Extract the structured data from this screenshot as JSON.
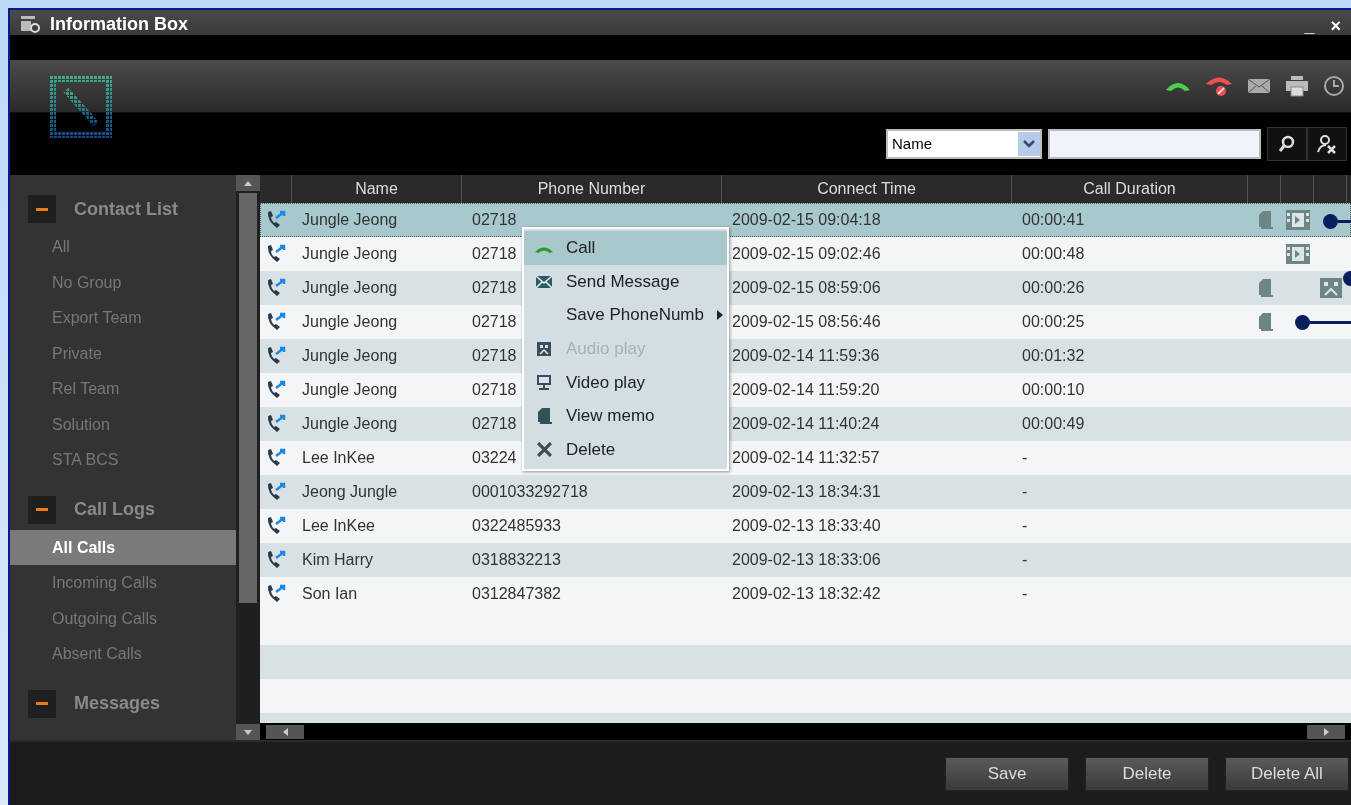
{
  "window": {
    "title": "Information Box",
    "minimize": "_",
    "close": "×"
  },
  "search": {
    "field_choice": "Name"
  },
  "sidebar": {
    "groups": [
      {
        "title": "Contact List",
        "expanded": true,
        "items": [
          {
            "label": "All",
            "selected": false
          },
          {
            "label": "No Group",
            "selected": false
          },
          {
            "label": "Export Team",
            "selected": false
          },
          {
            "label": "Private",
            "selected": false
          },
          {
            "label": "Rel Team",
            "selected": false
          },
          {
            "label": "Solution",
            "selected": false
          },
          {
            "label": "STA BCS",
            "selected": false
          }
        ]
      },
      {
        "title": "Call Logs",
        "expanded": true,
        "items": [
          {
            "label": "All Calls",
            "selected": true
          },
          {
            "label": "Incoming Calls",
            "selected": false
          },
          {
            "label": "Outgoing Calls",
            "selected": false
          },
          {
            "label": "Absent Calls",
            "selected": false
          }
        ]
      },
      {
        "title": "Messages",
        "expanded": true
      }
    ]
  },
  "table": {
    "columns": [
      "Name",
      "Phone Number",
      "Connect Time",
      "Call Duration"
    ],
    "rows": [
      {
        "name": "Jungle Jeong",
        "phone": "02718",
        "time": "2009-02-15 09:04:18",
        "duration": "00:00:41",
        "selected": true,
        "memo": true,
        "video": true,
        "audio": false
      },
      {
        "name": "Jungle Jeong",
        "phone": "02718",
        "time": "2009-02-15 09:02:46",
        "duration": "00:00:48",
        "selected": false,
        "memo": false,
        "video": true,
        "audio": false
      },
      {
        "name": "Jungle Jeong",
        "phone": "02718",
        "time": "2009-02-15 08:59:06",
        "duration": "00:00:26",
        "selected": false,
        "memo": true,
        "video": false,
        "audio": true
      },
      {
        "name": "Jungle Jeong",
        "phone": "02718",
        "time": "2009-02-15 08:56:46",
        "duration": "00:00:25",
        "selected": false,
        "memo": true,
        "video": false,
        "audio": false
      },
      {
        "name": "Jungle Jeong",
        "phone": "02718",
        "time": "2009-02-14 11:59:36",
        "duration": "00:01:32",
        "selected": false,
        "memo": false,
        "video": false,
        "audio": false
      },
      {
        "name": "Jungle Jeong",
        "phone": "02718",
        "time": "2009-02-14 11:59:20",
        "duration": "00:00:10",
        "selected": false,
        "memo": false,
        "video": false,
        "audio": false
      },
      {
        "name": "Jungle Jeong",
        "phone": "02718",
        "time": "2009-02-14 11:40:24",
        "duration": "00:00:49",
        "selected": false,
        "memo": false,
        "video": false,
        "audio": false
      },
      {
        "name": "Lee InKee",
        "phone": "03224",
        "time": "2009-02-14 11:32:57",
        "duration": "-",
        "selected": false,
        "memo": false,
        "video": false,
        "audio": false
      },
      {
        "name": "Jeong Jungle",
        "phone": "0001033292718",
        "time": "2009-02-13 18:34:31",
        "duration": "-",
        "selected": false,
        "memo": false,
        "video": false,
        "audio": false
      },
      {
        "name": "Lee InKee",
        "phone": "0322485933",
        "time": "2009-02-13 18:33:40",
        "duration": "-",
        "selected": false,
        "memo": false,
        "video": false,
        "audio": false
      },
      {
        "name": "Kim Harry",
        "phone": "0318832213",
        "time": "2009-02-13 18:33:06",
        "duration": "-",
        "selected": false,
        "memo": false,
        "video": false,
        "audio": false
      },
      {
        "name": "Son Ian",
        "phone": "0312847382",
        "time": "2009-02-13 18:32:42",
        "duration": "-",
        "selected": false,
        "memo": false,
        "video": false,
        "audio": false
      }
    ]
  },
  "context_menu": {
    "items": [
      {
        "label": "Call",
        "selected": true,
        "disabled": false,
        "submenu": false
      },
      {
        "label": "Send Message",
        "selected": false,
        "disabled": false,
        "submenu": false
      },
      {
        "label": "Save PhoneNumb",
        "selected": false,
        "disabled": false,
        "submenu": true
      },
      {
        "label": "Audio play",
        "selected": false,
        "disabled": true,
        "submenu": false
      },
      {
        "label": "Video play",
        "selected": false,
        "disabled": false,
        "submenu": false
      },
      {
        "label": "View memo",
        "selected": false,
        "disabled": false,
        "submenu": false
      },
      {
        "label": "Delete",
        "selected": false,
        "disabled": false,
        "submenu": false
      }
    ]
  },
  "buttons": [
    "Save",
    "Delete",
    "Delete All"
  ]
}
